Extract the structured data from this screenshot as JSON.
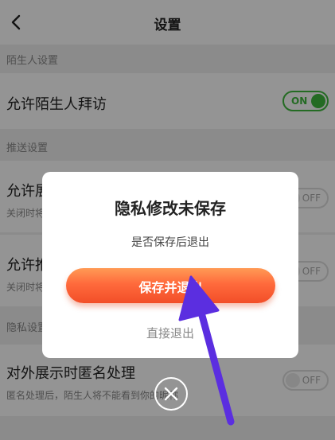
{
  "header": {
    "title": "设置",
    "back_icon": "chevron-left-icon"
  },
  "sections": [
    {
      "header": "陌生人设置"
    },
    {
      "header": "推送设置"
    },
    {
      "header": "隐私设置"
    }
  ],
  "rows": [
    {
      "label": "允许陌生人拜访",
      "sublabel": "",
      "toggle": "ON",
      "on": true
    },
    {
      "label": "允许展示在线状态",
      "sublabel": "关闭时将不会被推送",
      "toggle": "OFF",
      "on": false
    },
    {
      "label": "允许推送消息提醒",
      "sublabel": "关闭时将不会被推送",
      "toggle": "OFF",
      "on": false
    },
    {
      "label": "对外展示时匿名处理",
      "sublabel": "匿名处理后，陌生人将不能看到你的昵称",
      "toggle": "OFF",
      "on": false
    }
  ],
  "dialog": {
    "title": "隐私修改未保存",
    "message": "是否保存后退出",
    "save_label": "保存并退出",
    "exit_label": "直接退出",
    "close_icon": "close-icon"
  },
  "annotation": {
    "icon": "pointer-arrow-icon",
    "color": "#5b2ee0"
  },
  "colors": {
    "toggle_on": "#3fb83d",
    "button_start": "#ff9a55",
    "button_end": "#f24e28"
  }
}
